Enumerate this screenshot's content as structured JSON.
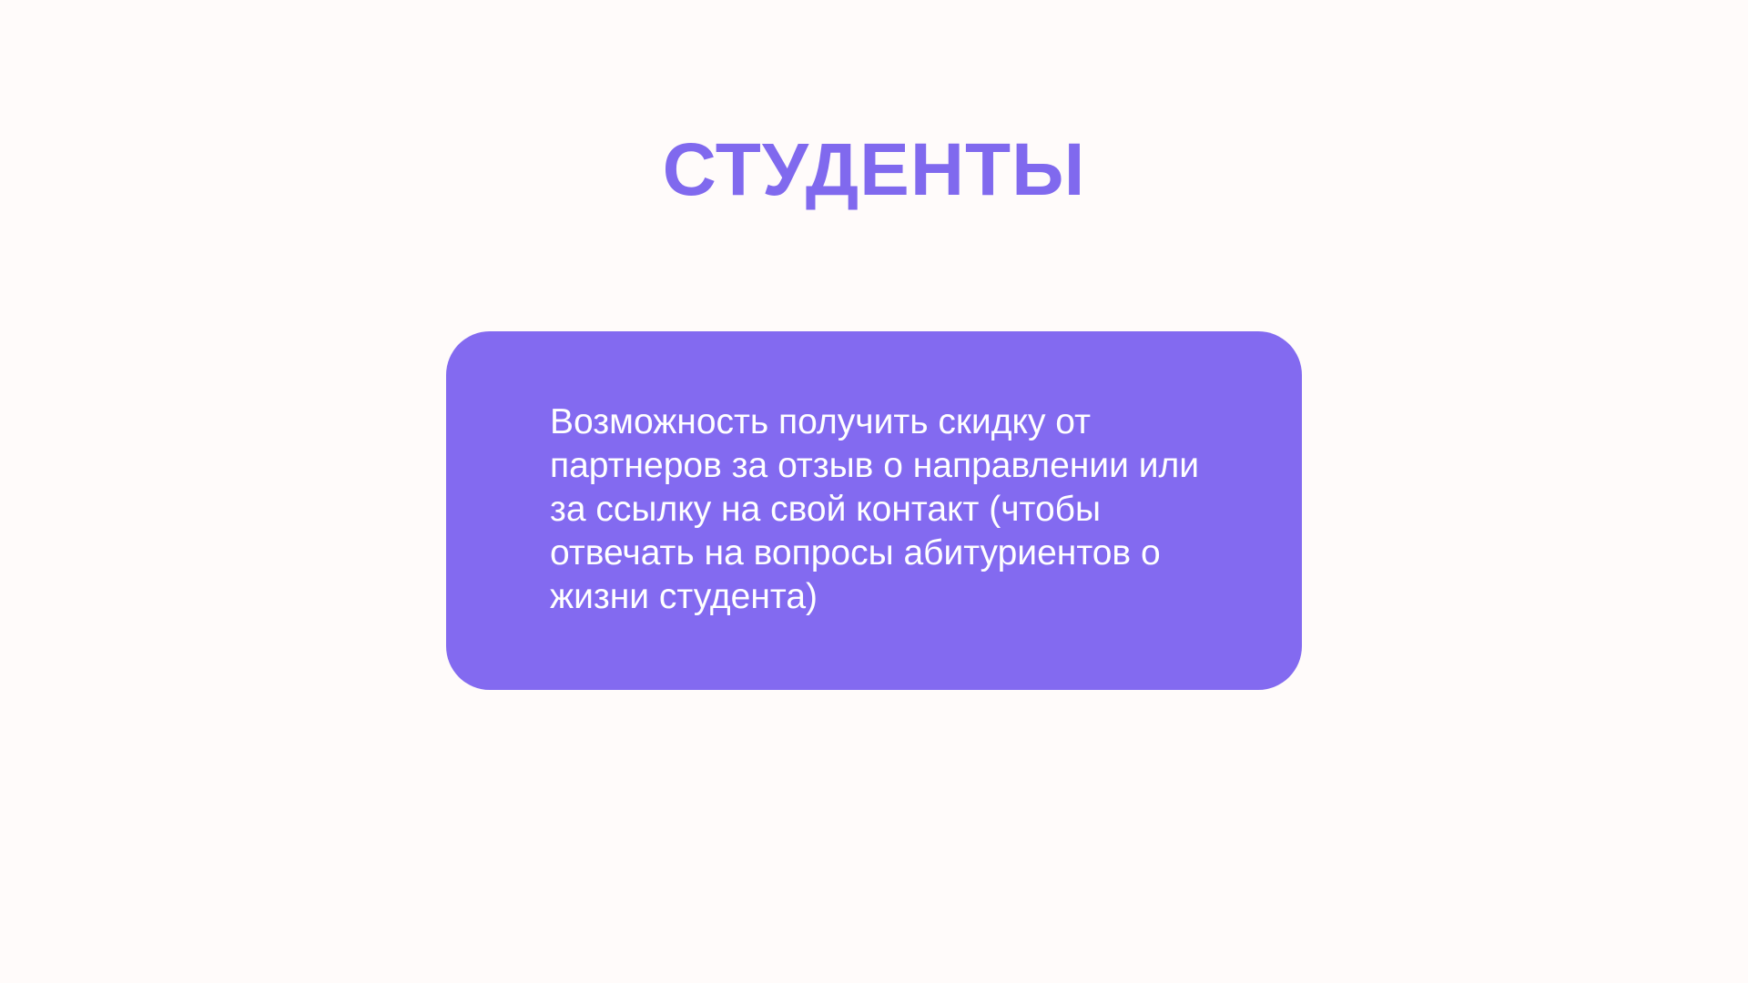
{
  "title": "СТУДЕНТЫ",
  "card": {
    "text": "Возможность получить скидку от партнеров за отзыв о направлении или за ссылку на свой контакт (чтобы отвечать на вопросы абитуриентов о жизни студента)"
  },
  "colors": {
    "background": "#fffbfa",
    "accent": "#836af0"
  }
}
